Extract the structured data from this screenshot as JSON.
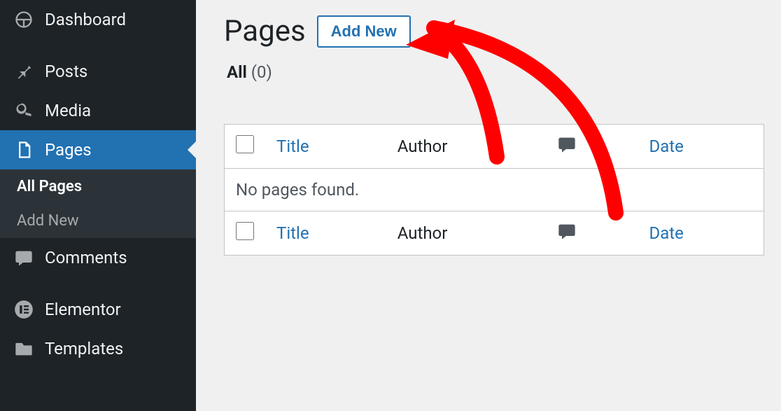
{
  "sidebar": {
    "items": [
      {
        "label": "Dashboard",
        "icon": "dashboard"
      },
      {
        "label": "Posts",
        "icon": "pin"
      },
      {
        "label": "Media",
        "icon": "media"
      },
      {
        "label": "Pages",
        "icon": "page",
        "active": true
      },
      {
        "label": "Comments",
        "icon": "comment"
      },
      {
        "label": "Elementor",
        "icon": "elementor"
      },
      {
        "label": "Templates",
        "icon": "folder"
      }
    ],
    "submenu": [
      {
        "label": "All Pages",
        "current": true
      },
      {
        "label": "Add New"
      }
    ]
  },
  "header": {
    "title": "Pages",
    "add_new": "Add New"
  },
  "filter": {
    "all_label": "All",
    "all_count": "(0)"
  },
  "table": {
    "columns": {
      "title": "Title",
      "author": "Author",
      "date": "Date"
    },
    "empty_message": "No pages found."
  },
  "annotation": {
    "color": "#ff0000"
  }
}
